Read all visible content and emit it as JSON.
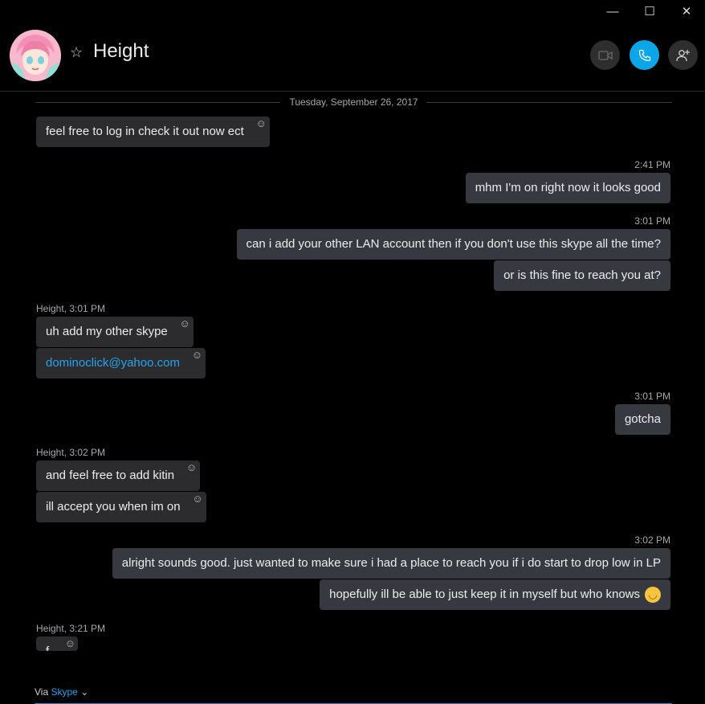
{
  "window": {
    "minimize_glyph": "—",
    "maximize_glyph": "☐",
    "close_glyph": "✕"
  },
  "header": {
    "contact_name": "Height",
    "favorite_glyph": "☆"
  },
  "conversation": {
    "date_separator": "Tuesday, September 26, 2017",
    "messages": [
      {
        "text": "feel free to log in check it out now ect"
      },
      {
        "time": "2:41 PM",
        "text": "mhm I'm on right now it looks good"
      },
      {
        "time": "3:01 PM",
        "text": "can i add your other LAN account then if you don't use this skype all the time?"
      },
      {
        "text": "or is this fine to reach you at?"
      },
      {
        "sender": "Height, 3:01 PM",
        "text": "uh add my other skype"
      },
      {
        "text": "dominoclick@yahoo.com"
      },
      {
        "time": "3:01 PM",
        "text": "gotcha"
      },
      {
        "sender": "Height, 3:02 PM",
        "text": "and feel free to add kitin"
      },
      {
        "text": "ill accept you when im on"
      },
      {
        "time": "3:02 PM",
        "text": "alright sounds good. just wanted to make sure i had a place to reach you if i do start to drop low in LP"
      },
      {
        "text": "hopefully ill be able to just keep it in myself but who knows"
      },
      {
        "sender": "Height, 3:21 PM",
        "text": "f"
      }
    ],
    "react_glyph": "☺",
    "emoji_glyph": "◡"
  },
  "footer": {
    "via_label": "Via",
    "via_source": "Skype",
    "dropdown_glyph": "⌄"
  }
}
